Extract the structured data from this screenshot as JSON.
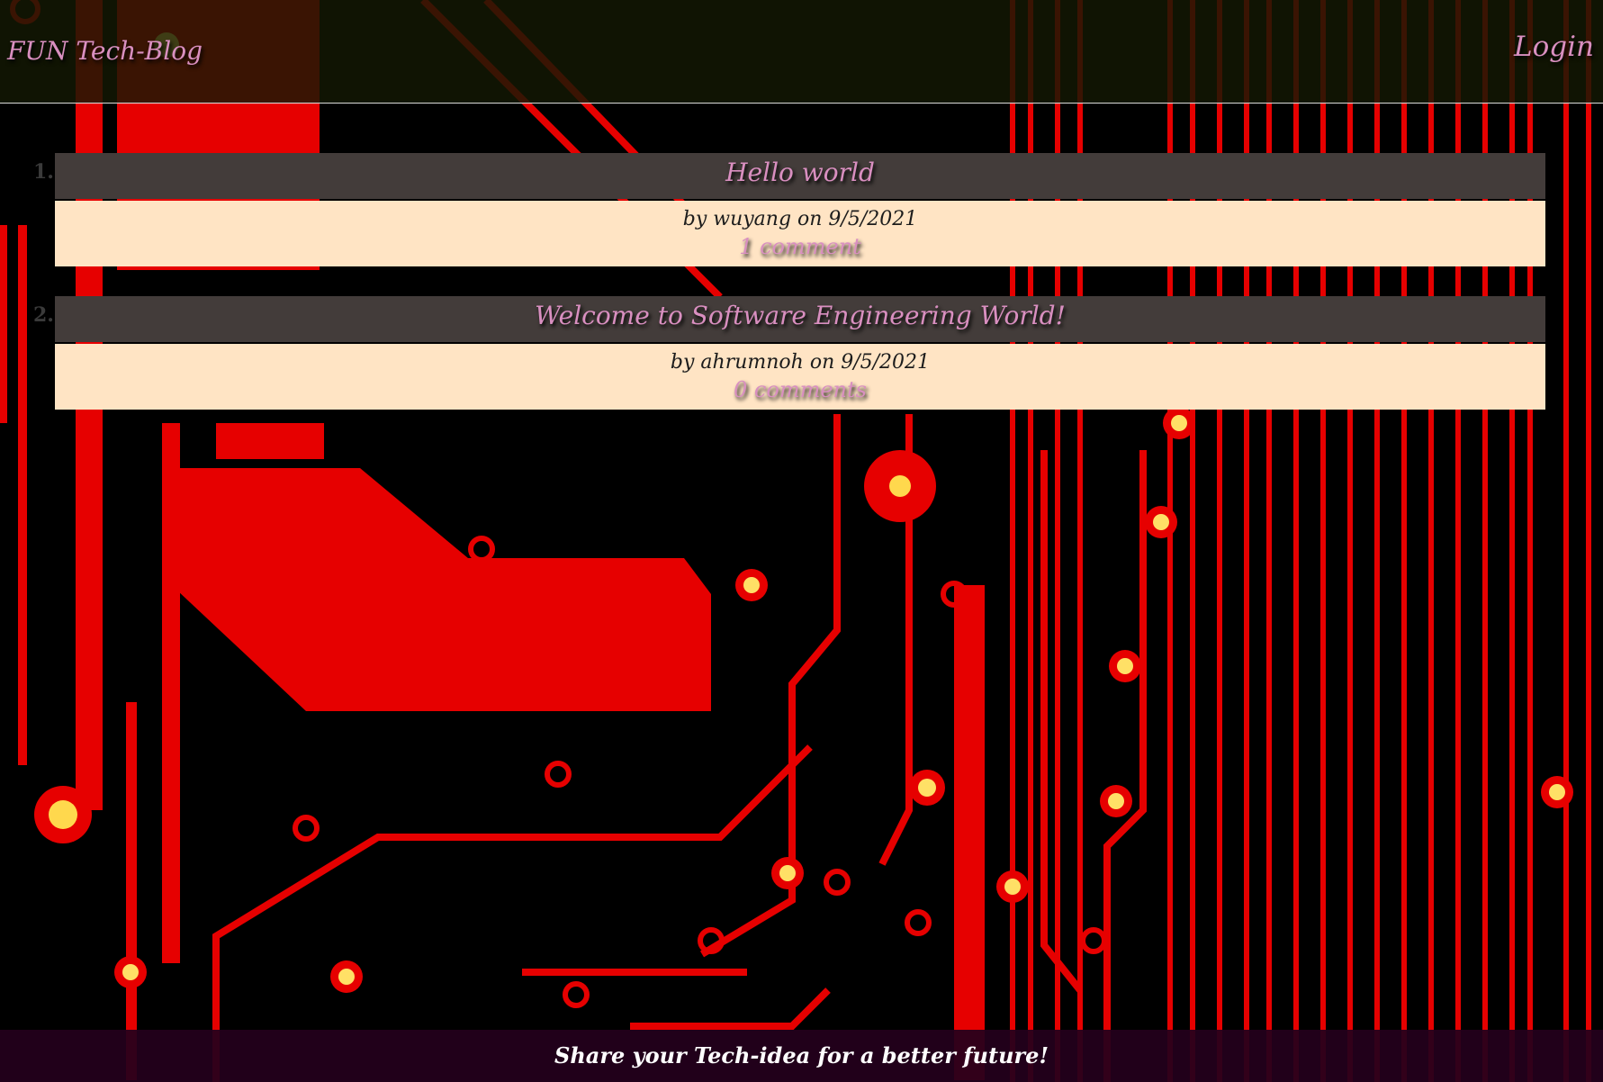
{
  "header": {
    "brand": "FUN Tech-Blog",
    "login_label": "Login"
  },
  "posts": [
    {
      "number": "1.",
      "title": "Hello world",
      "byline": "by wuyang on 9/5/2021",
      "comments_label": "1 comment"
    },
    {
      "number": "2.",
      "title": "Welcome to Software Engineering World!",
      "byline": "by ahrumnoh on 9/5/2021",
      "comments_label": "0 comments"
    }
  ],
  "footer": {
    "tagline": "Share your Tech-idea for a better future!"
  },
  "colors": {
    "accent_pink": "#d98fc0",
    "post_header_bg": "#433c3a",
    "post_body_bg": "#ffe4c4",
    "footer_bg": "#23001c",
    "background_trace_red": "#e60000"
  },
  "icons": [
    "circuit-board-background"
  ]
}
